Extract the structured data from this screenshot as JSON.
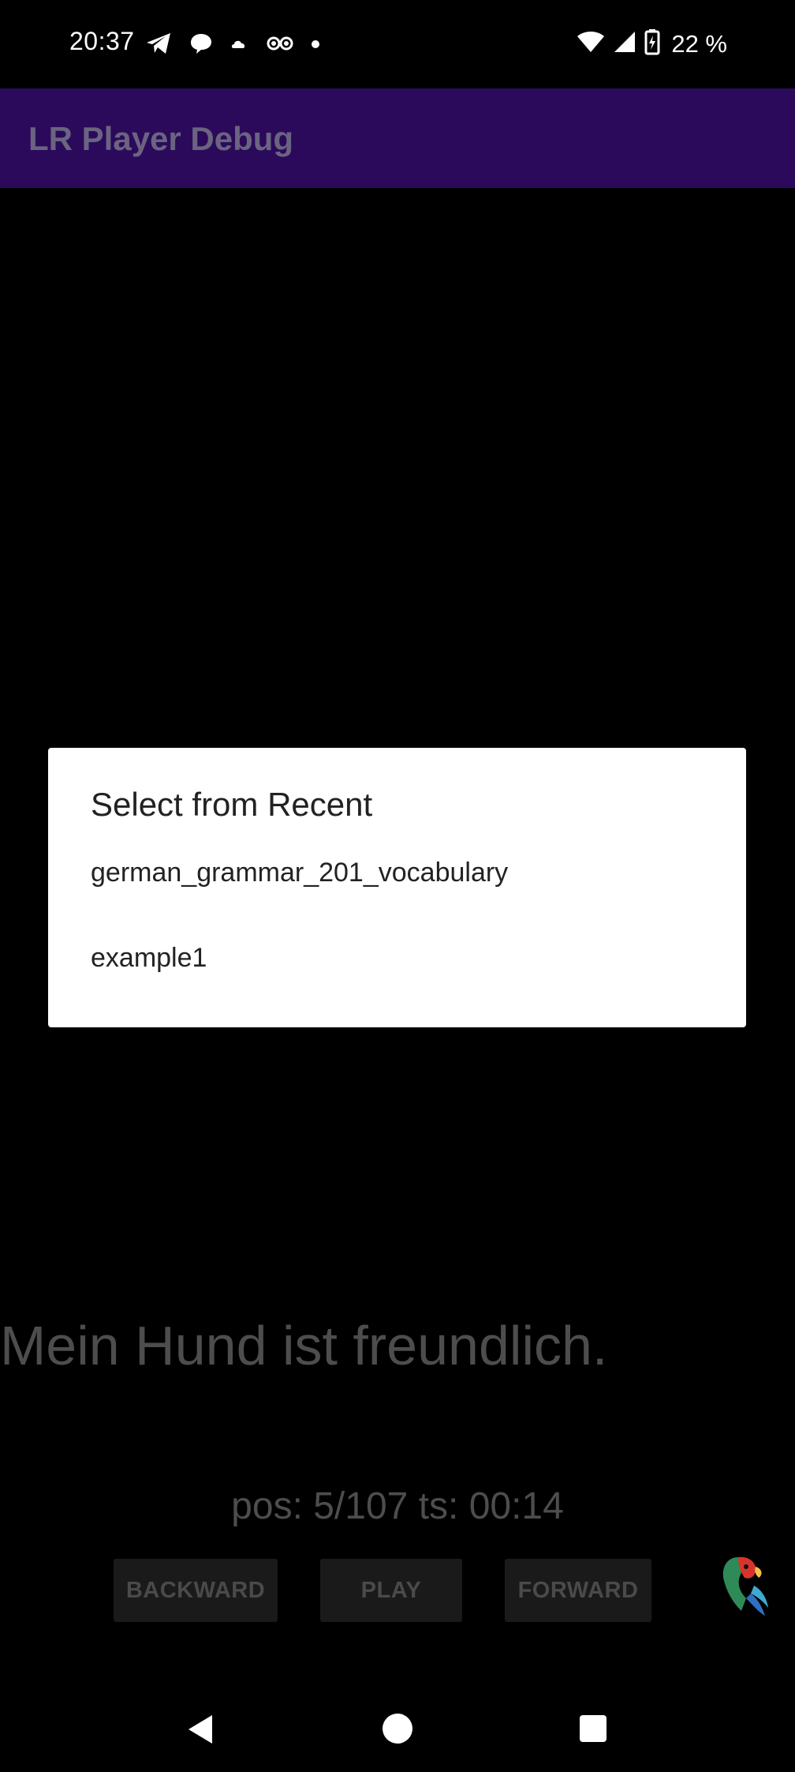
{
  "status_bar": {
    "time": "20:37",
    "battery_percent": "22 %",
    "left_icons": [
      "telegram-icon",
      "chat-bubble-icon",
      "cloud-icon",
      "glasses-app-icon",
      "dot-icon"
    ],
    "right_icons": [
      "wifi-icon",
      "cell-signal-icon",
      "battery-charging-icon"
    ]
  },
  "app_bar": {
    "title": "LR Player Debug",
    "color": "#2b0a5c"
  },
  "main": {
    "sentence": "Mein Hund ist freundlich.",
    "position_readout": "pos: 5/107 ts: 00:14",
    "controls": {
      "backward_label": "BACKWARD",
      "play_label": "PLAY",
      "forward_label": "FORWARD"
    }
  },
  "dialog": {
    "title": "Select from Recent",
    "items": [
      {
        "label": "german_grammar_201_vocabulary"
      },
      {
        "label": "example1"
      }
    ]
  },
  "nav_bar": {
    "icons": [
      "back-icon",
      "home-icon",
      "recents-icon"
    ]
  }
}
